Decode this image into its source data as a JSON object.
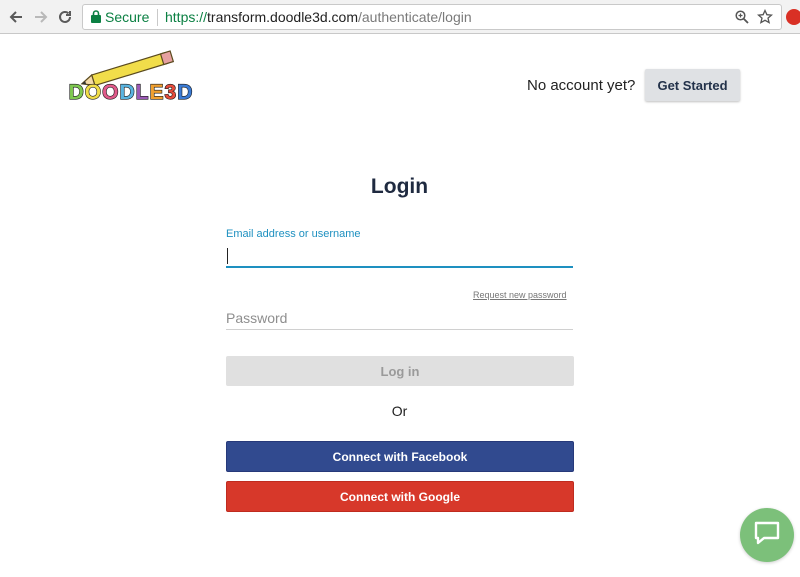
{
  "browser": {
    "secure_label": "Secure",
    "url_scheme": "https://",
    "url_host": "transform.doodle3d.com",
    "url_path": "/authenticate/login"
  },
  "header": {
    "logo_text": "DOODLE3D",
    "no_account_text": "No account yet?",
    "get_started_label": "Get Started"
  },
  "login": {
    "title": "Login",
    "email_label": "Email address or username",
    "email_value": "",
    "request_password_link": "Request new password",
    "password_placeholder": "Password",
    "login_button": "Log in",
    "or_text": "Or",
    "facebook_button": "Connect with Facebook",
    "google_button": "Connect with Google"
  },
  "colors": {
    "accent": "#1e90c0",
    "facebook": "#314a8f",
    "google": "#d7382a",
    "chat": "#7cc07a"
  }
}
